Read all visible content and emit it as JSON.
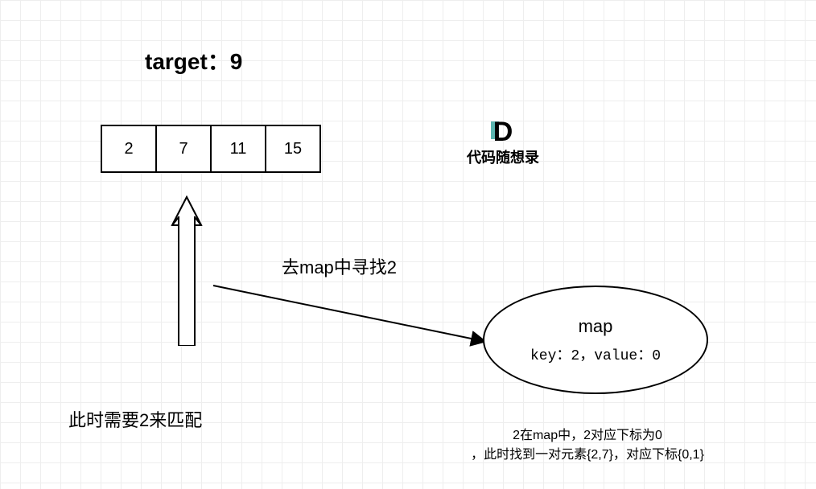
{
  "target_label": "target：9",
  "array": [
    "2",
    "7",
    "11",
    "15"
  ],
  "arrow_label": "去map中寻找2",
  "map": {
    "title": "map",
    "kv": "key：2，value：0"
  },
  "match_label": "此时需要2来匹配",
  "result_line1": "2在map中，2对应下标为0",
  "result_line2": "，此时找到一对元素{2,7}，对应下标{0,1}",
  "watermark": "代码随想录"
}
